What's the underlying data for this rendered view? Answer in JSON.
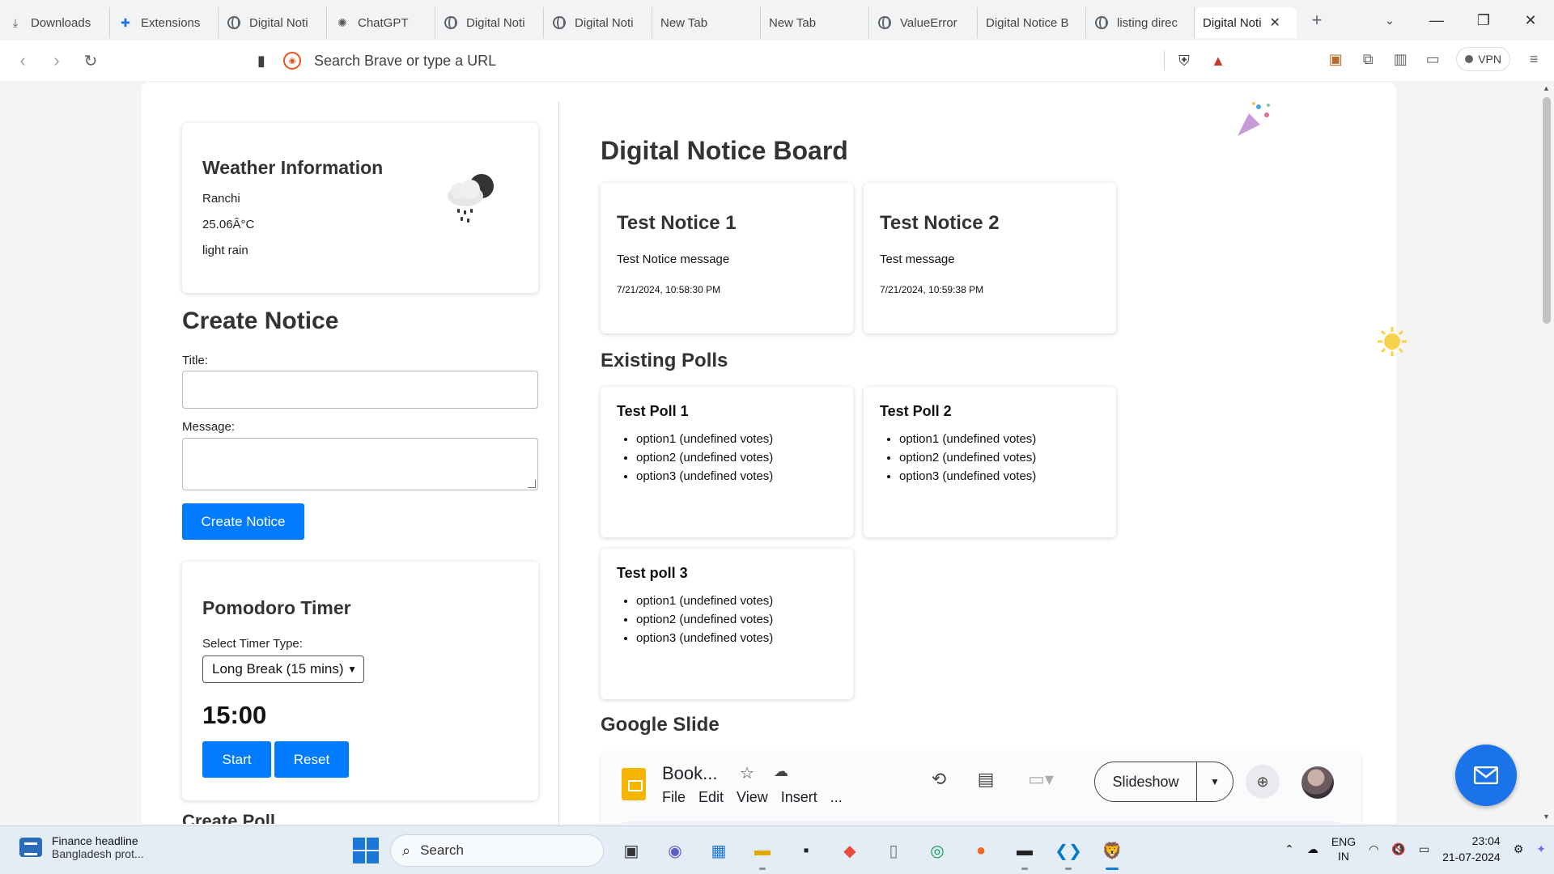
{
  "browser": {
    "tabs": [
      {
        "label": "Downloads",
        "icon": "download-icon",
        "width": 134
      },
      {
        "label": "Extensions",
        "icon": "puzzle-icon",
        "width": 134
      },
      {
        "label": "Digital Noti",
        "icon": "globe-icon",
        "width": 134
      },
      {
        "label": "ChatGPT",
        "icon": "chatgpt-icon",
        "width": 134
      },
      {
        "label": "Digital Noti",
        "icon": "globe-icon",
        "width": 134
      },
      {
        "label": "Digital Noti",
        "icon": "globe-icon",
        "width": 134
      },
      {
        "label": "New Tab",
        "icon": "",
        "width": 134
      },
      {
        "label": "New Tab",
        "icon": "",
        "width": 134
      },
      {
        "label": "ValueError",
        "icon": "globe-icon",
        "width": 134
      },
      {
        "label": "Digital Notice B",
        "icon": "",
        "width": 134
      },
      {
        "label": "listing direc",
        "icon": "globe-icon",
        "width": 134
      }
    ],
    "active_tab": "Digital Noti",
    "address_placeholder": "Search Brave or type a URL",
    "vpn_label": "VPN"
  },
  "weather": {
    "title": "Weather Information",
    "city": "Ranchi",
    "temperature": "25.06Â°C",
    "description": "light rain"
  },
  "create_notice": {
    "title": "Create Notice",
    "title_label": "Title:",
    "message_label": "Message:",
    "submit_label": "Create Notice"
  },
  "pomodoro": {
    "title": "Pomodoro Timer",
    "select_label": "Select Timer Type:",
    "selected_option": "Long Break (15 mins)",
    "time": "15:00",
    "start_label": "Start",
    "reset_label": "Reset"
  },
  "create_poll": {
    "title": "Create Poll"
  },
  "board": {
    "title": "Digital Notice Board",
    "notices": [
      {
        "title": "Test Notice 1",
        "message": "Test Notice message",
        "timestamp": "7/21/2024, 10:58:30 PM"
      },
      {
        "title": "Test Notice 2",
        "message": "Test message",
        "timestamp": "7/21/2024, 10:59:38 PM"
      }
    ],
    "polls_title": "Existing Polls",
    "polls": [
      {
        "title": "Test Poll 1",
        "options": [
          "option1 (undefined votes)",
          "option2 (undefined votes)",
          "option3 (undefined votes)"
        ]
      },
      {
        "title": "Test Poll 2",
        "options": [
          "option1 (undefined votes)",
          "option2 (undefined votes)",
          "option3 (undefined votes)"
        ]
      },
      {
        "title": "Test poll 3",
        "options": [
          "option1 (undefined votes)",
          "option2 (undefined votes)",
          "option3 (undefined votes)"
        ]
      }
    ],
    "slides_title": "Google Slide"
  },
  "slides": {
    "doc_name": "Book...",
    "menu": [
      "File",
      "Edit",
      "View",
      "Insert",
      "..."
    ],
    "slideshow_label": "Slideshow"
  },
  "taskbar": {
    "news_title": "Finance headline",
    "news_sub": "Bangladesh prot...",
    "search_label": "Search",
    "lang_top": "ENG",
    "lang_bottom": "IN",
    "time": "23:04",
    "date": "21-07-2024"
  },
  "colors": {
    "primary_button": "#007bff",
    "fab": "#1a73e8",
    "slides_icon": "#f4b400"
  }
}
